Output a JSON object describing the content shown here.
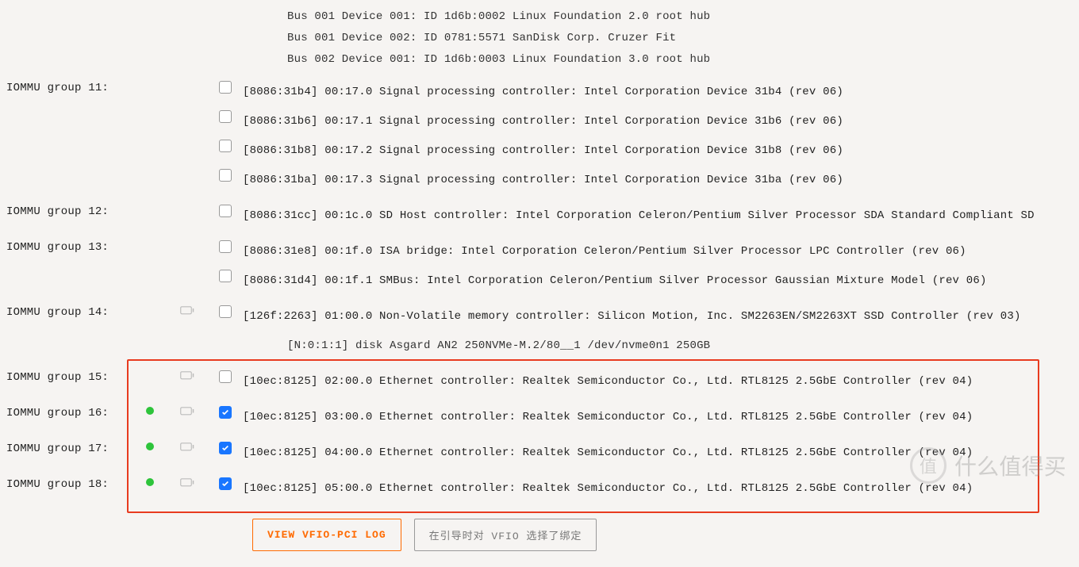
{
  "header_sub": [
    "Bus 001 Device 001: ID 1d6b:0002 Linux Foundation 2.0 root hub",
    "Bus 001 Device 002: ID 0781:5571 SanDisk Corp. Cruzer Fit",
    "Bus 002 Device 001: ID 1d6b:0003 Linux Foundation 3.0 root hub"
  ],
  "groups": [
    {
      "label": "IOMMU group 11:",
      "rows": [
        {
          "cb": false,
          "text": "[8086:31b4] 00:17.0 Signal processing controller: Intel Corporation Device 31b4 (rev 06)"
        },
        {
          "cb": false,
          "text": "[8086:31b6] 00:17.1 Signal processing controller: Intel Corporation Device 31b6 (rev 06)"
        },
        {
          "cb": false,
          "text": "[8086:31b8] 00:17.2 Signal processing controller: Intel Corporation Device 31b8 (rev 06)"
        },
        {
          "cb": false,
          "text": "[8086:31ba] 00:17.3 Signal processing controller: Intel Corporation Device 31ba (rev 06)"
        }
      ]
    },
    {
      "label": "IOMMU group 12:",
      "rows": [
        {
          "cb": false,
          "text": "[8086:31cc] 00:1c.0 SD Host controller: Intel Corporation Celeron/Pentium Silver Processor SDA Standard Compliant SD"
        }
      ]
    },
    {
      "label": "IOMMU group 13:",
      "rows": [
        {
          "cb": false,
          "text": "[8086:31e8] 00:1f.0 ISA bridge: Intel Corporation Celeron/Pentium Silver Processor LPC Controller (rev 06)"
        },
        {
          "cb": false,
          "text": "[8086:31d4] 00:1f.1 SMBus: Intel Corporation Celeron/Pentium Silver Processor Gaussian Mixture Model (rev 06)"
        }
      ]
    },
    {
      "label": "IOMMU group 14:",
      "rows": [
        {
          "cb": false,
          "dev": true,
          "text": "[126f:2263] 01:00.0 Non-Volatile memory controller: Silicon Motion, Inc. SM2263EN/SM2263XT SSD Controller (rev 03)"
        }
      ],
      "sub": [
        "[N:0:1:1]    disk    Asgard AN2 250NVMe-M.2/80__1              /dev/nvme0n1    250GB"
      ]
    },
    {
      "label": "IOMMU group 15:",
      "rows": [
        {
          "cb": false,
          "dev": true,
          "text": "[10ec:8125] 02:00.0 Ethernet controller: Realtek Semiconductor Co., Ltd. RTL8125 2.5GbE Controller (rev 04)"
        }
      ]
    },
    {
      "label": "IOMMU group 16:",
      "rows": [
        {
          "cb": true,
          "dev": true,
          "status": "green",
          "text": "[10ec:8125] 03:00.0 Ethernet controller: Realtek Semiconductor Co., Ltd. RTL8125 2.5GbE Controller (rev 04)"
        }
      ]
    },
    {
      "label": "IOMMU group 17:",
      "rows": [
        {
          "cb": true,
          "dev": true,
          "status": "green",
          "text": "[10ec:8125] 04:00.0 Ethernet controller: Realtek Semiconductor Co., Ltd. RTL8125 2.5GbE Controller (rev 04)"
        }
      ]
    },
    {
      "label": "IOMMU group 18:",
      "rows": [
        {
          "cb": true,
          "dev": true,
          "status": "green",
          "text": "[10ec:8125] 05:00.0 Ethernet controller: Realtek Semiconductor Co., Ltd. RTL8125 2.5GbE Controller (rev 04)"
        }
      ]
    }
  ],
  "buttons": {
    "primary": "VIEW VFIO-PCI LOG",
    "secondary": "在引导时对 VFIO 选择了绑定"
  },
  "watermark": {
    "badge": "值",
    "text": "什么值得买"
  }
}
